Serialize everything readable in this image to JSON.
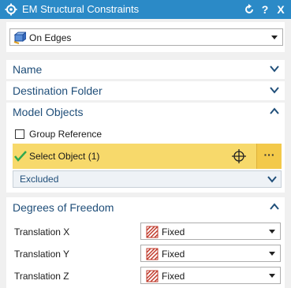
{
  "window": {
    "title": "EM Structural Constraints",
    "reset_icon": "reset-icon",
    "help_label": "?",
    "close_label": "X"
  },
  "type_selector": {
    "value": "On Edges",
    "icon": "edge-constraint-icon"
  },
  "sections": {
    "name": {
      "label": "Name",
      "expanded": false
    },
    "destination_folder": {
      "label": "Destination Folder",
      "expanded": false
    },
    "model_objects": {
      "label": "Model Objects",
      "expanded": true,
      "group_reference": {
        "label": "Group Reference",
        "checked": false
      },
      "select_object": {
        "label": "Select Object (1)",
        "more_label": "···"
      },
      "excluded": {
        "label": "Excluded",
        "expanded": false
      }
    },
    "degrees_of_freedom": {
      "label": "Degrees of Freedom",
      "expanded": true,
      "rows": [
        {
          "label": "Translation X",
          "value": "Fixed"
        },
        {
          "label": "Translation Y",
          "value": "Fixed"
        },
        {
          "label": "Translation Z",
          "value": "Fixed"
        }
      ]
    }
  },
  "colors": {
    "titlebar": "#2b8ac7",
    "section_text": "#1f4e79",
    "highlight": "#f7d96b",
    "check_green": "#2fa84f"
  }
}
